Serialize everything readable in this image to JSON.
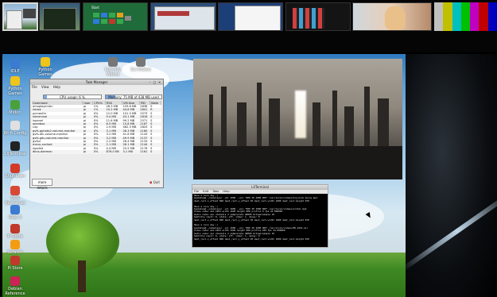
{
  "desktop_icons": [
    {
      "label": "IDLE",
      "color": "#3b7bd1"
    },
    {
      "label": "Python Games",
      "color": "#f0c419"
    },
    {
      "label": "Midori",
      "color": "#4aa03a"
    },
    {
      "label": "Wi-fi Config",
      "color": "#e0e0e0"
    },
    {
      "label": "LXTerminal",
      "color": "#222222"
    },
    {
      "label": "Shutdown",
      "color": "#d23a2a"
    },
    {
      "label": "OCR Resources",
      "color": "#d84a35"
    },
    {
      "label": "IDLE 3",
      "color": "#3b7bd1"
    },
    {
      "label": "Pi Store",
      "color": "#c0392b"
    },
    {
      "label": "Scratch",
      "color": "#f39c12"
    },
    {
      "label": "Pi Store",
      "color": "#c0392b"
    },
    {
      "label": "Debian Reference",
      "color": "#cc2255"
    }
  ],
  "top_icons": [
    {
      "label": "Python Games",
      "color": "#f0c419"
    },
    {
      "label": "Cornelly Videos",
      "color": "#777777"
    },
    {
      "label": "Sci-Videos",
      "color": "#777777"
    }
  ],
  "thumbnails": {
    "start_label": "Start",
    "color_bars": [
      "#c0c0c0",
      "#c0c000",
      "#00c0c0",
      "#00c000",
      "#c000c0",
      "#c00000",
      "#0000c0"
    ]
  },
  "taskman": {
    "title": "Task Manager",
    "menu": [
      "File",
      "View",
      "Help"
    ],
    "cpu_label": "CPU usage: 6 %",
    "cpu_fraction": 0.06,
    "mem_label": "Memory: 75 MB of 438 MB used",
    "mem_fraction": 0.17,
    "columns": [
      "Command",
      "User",
      "CPU%",
      "RSS",
      "VM-Size",
      "PID",
      "State"
    ],
    "rows": [
      [
        "omxplayer.bin",
        "pi",
        "1%",
        "28.3 MB",
        "155.6 MB",
        "2838",
        "S"
      ],
      [
        "lxtask",
        "pi",
        "1%",
        "10.2 MB",
        "44.8 MB",
        "2841",
        "R"
      ],
      [
        "pcmanfm",
        "pi",
        "0%",
        "12.0 MB",
        "101.3 MB",
        "2573",
        "S"
      ],
      [
        "lxterminal",
        "pi",
        "0%",
        "9.4 MB",
        "43.1 MB",
        "2818",
        "S"
      ],
      [
        "lxpanel",
        "pi",
        "0%",
        "11.6 MB",
        "99.2 MB",
        "2571",
        "S"
      ],
      [
        "openbox",
        "pi",
        "0%",
        "6.5 MB",
        "15.8 MB",
        "2167",
        "S"
      ],
      [
        "cup",
        "pi",
        "0%",
        "2.9 MB",
        "462.3 MB",
        "2820",
        "S"
      ],
      [
        "gvfs-gphoto2-volume-monitor",
        "pi",
        "0%",
        "3.1 MB",
        "28.3 MB",
        "2160",
        "S"
      ],
      [
        "gvfs-afc-volume-monitor",
        "pi",
        "0%",
        "3.2 MB",
        "41.8 MB",
        "2143",
        "S"
      ],
      [
        "gvfs-gdu-volume-monitor",
        "pi",
        "0%",
        "3.2 MB",
        "49.9 MB",
        "2137",
        "S"
      ],
      [
        "gvfsd",
        "pi",
        "0%",
        "2.2 MB",
        "26.4 MB",
        "2133",
        "S"
      ],
      [
        "menu-cached",
        "pi",
        "0%",
        "2.1 MB",
        "26.1 MB",
        "2144",
        "S"
      ],
      [
        "lxpolkit",
        "pi",
        "0%",
        "4.4 MB",
        "25.5 MB",
        "2176",
        "S"
      ],
      [
        "dbus-daemon",
        "pi",
        "0%",
        "876.0 KB",
        "3.1 MB",
        "2161",
        "S"
      ]
    ],
    "more_details": "more details",
    "quit": "Quit"
  },
  "terminal": {
    "title": "LXTerminal",
    "menu": [
      "File",
      "Edit",
      "Tabs",
      "Help"
    ],
    "lines": [
      "Have a nice day ;)",
      "bookshop@ ~/omxplayer -vol 1000 --win \"800 30 1800 900\" /usr/local/videos/big-buck-bunny.mp4",
      "dest_rect.x_offset 800 dest_rect.y_offset 30 dest_rect.width 1000 dest_rect.height 870",
      "",
      "Have a nice day ;)",
      "bookshop@ ~/omxplayer -vol 1000 --win \"800 30 1800 900\" /usr/local/videos/sintel.mp4",
      "Video codec omx-h264 width 1920 height 800 profile 0 fps 24.000000",
      "Audio codec aac channels 2 samplerate 48000 bitspersample 16",
      "Subtitle count: 0, state: off, index: 1, delay: 0",
      "dest_rect.x_offset 800 dest_rect.y_offset 30 dest_rect.width 1000 dest_rect.height 870",
      "",
      "Have a nice day ;)",
      "bookshop@ ~/omxplayer -vol 1000 --win \"800 30 1800 900\" /usr/local/videos/ED_1024.avi",
      "Video codec omx-h264 width 1920 height 800 profile 100 fps 24.000000",
      "Audio codec aac channels 2 samplerate 48000 bitspersample 16",
      "Subtitle count: 0, state: off, index: 1, delay: 0",
      "dest_rect.x_offset 800 dest_rect.y_offset 30 dest_rect.width 1000 dest_rect.height 870"
    ]
  },
  "colors": {
    "accent": "#7aa7e0",
    "terminal_bg": "#000000",
    "desktop_sky": "#5ea0d8",
    "grass": "#3f8a24"
  }
}
